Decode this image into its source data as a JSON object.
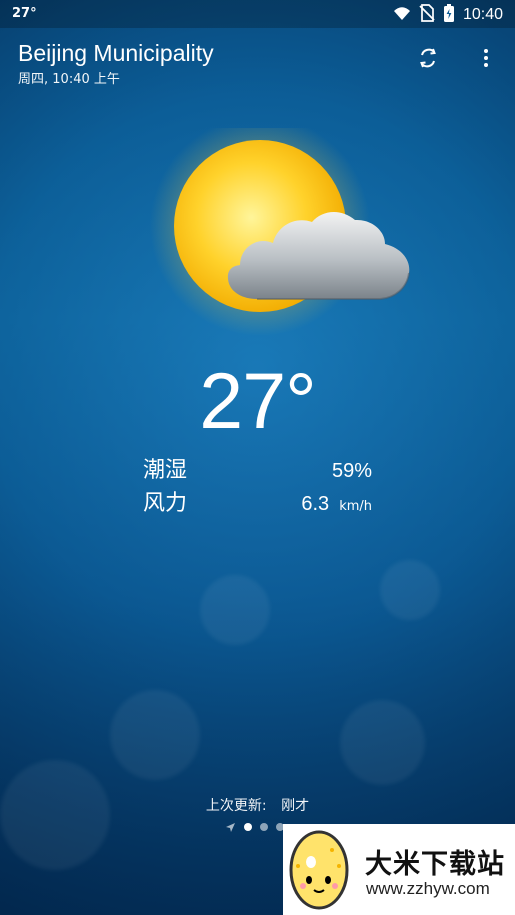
{
  "status_bar": {
    "temp": "27°",
    "time": "10:40",
    "icons": [
      "wifi-icon",
      "no-sim-icon",
      "battery-charging-icon"
    ]
  },
  "header": {
    "city": "Beijing Municipality",
    "day": "周四,",
    "time": "10:40 上午",
    "actions": [
      "refresh-icon",
      "more-options-icon"
    ]
  },
  "weather": {
    "condition_icon": "partly-cloudy-icon",
    "temperature": "27°"
  },
  "metrics": {
    "humidity_label": "潮湿",
    "humidity_value": "59%",
    "wind_label": "风力",
    "wind_value": "6.3",
    "wind_unit": "km/h"
  },
  "update": {
    "label": "上次更新:",
    "value": "刚才"
  },
  "pager": {
    "current_index": 1,
    "count": 3,
    "location_indicator_icon": "location-arrow-icon"
  },
  "watermark": {
    "title": "大米下载站",
    "url": "www.zzhyw.com"
  }
}
